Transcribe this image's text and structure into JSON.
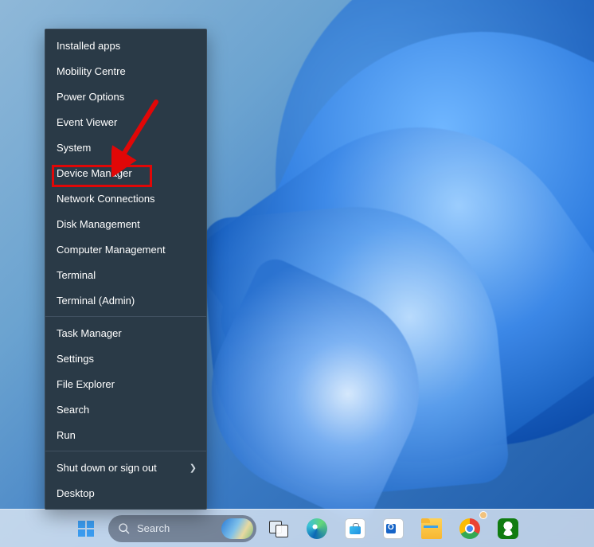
{
  "menu": {
    "items": [
      {
        "label": "Installed apps"
      },
      {
        "label": "Mobility Centre"
      },
      {
        "label": "Power Options"
      },
      {
        "label": "Event Viewer"
      },
      {
        "label": "System"
      },
      {
        "label": "Device Manager",
        "highlighted": true
      },
      {
        "label": "Network Connections"
      },
      {
        "label": "Disk Management"
      },
      {
        "label": "Computer Management"
      },
      {
        "label": "Terminal"
      },
      {
        "label": "Terminal (Admin)"
      }
    ],
    "group2": [
      {
        "label": "Task Manager"
      },
      {
        "label": "Settings"
      },
      {
        "label": "File Explorer"
      },
      {
        "label": "Search"
      },
      {
        "label": "Run"
      }
    ],
    "group3": [
      {
        "label": "Shut down or sign out",
        "submenu": true
      },
      {
        "label": "Desktop"
      }
    ]
  },
  "taskbar": {
    "search_placeholder": "Search",
    "icons": [
      "start-icon",
      "search-box",
      "task-view-icon",
      "edge-icon",
      "microsoft-store-icon",
      "outlook-icon",
      "file-explorer-icon",
      "chrome-icon",
      "xbox-icon"
    ]
  },
  "annotation": {
    "highlight_target": "Device Manager",
    "arrow_color": "#e10707"
  },
  "colors": {
    "menu_bg": "#2a3a47",
    "menu_text": "#ffffff",
    "highlight_border": "#e10707"
  }
}
